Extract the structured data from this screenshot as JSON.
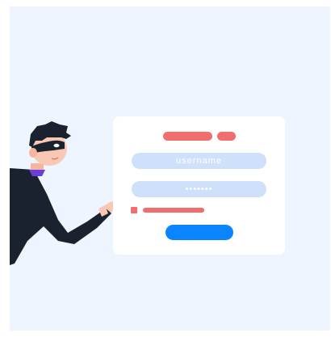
{
  "login_form": {
    "username_placeholder": "username",
    "password_placeholder": "•••••••"
  },
  "colors": {
    "accent": "#0a84ff",
    "error": "#f26d6d",
    "field": "#cfe0fb",
    "background": "#eef5fe",
    "figure": "#1a222f"
  },
  "icons": {
    "figure": "thief-illustration"
  }
}
